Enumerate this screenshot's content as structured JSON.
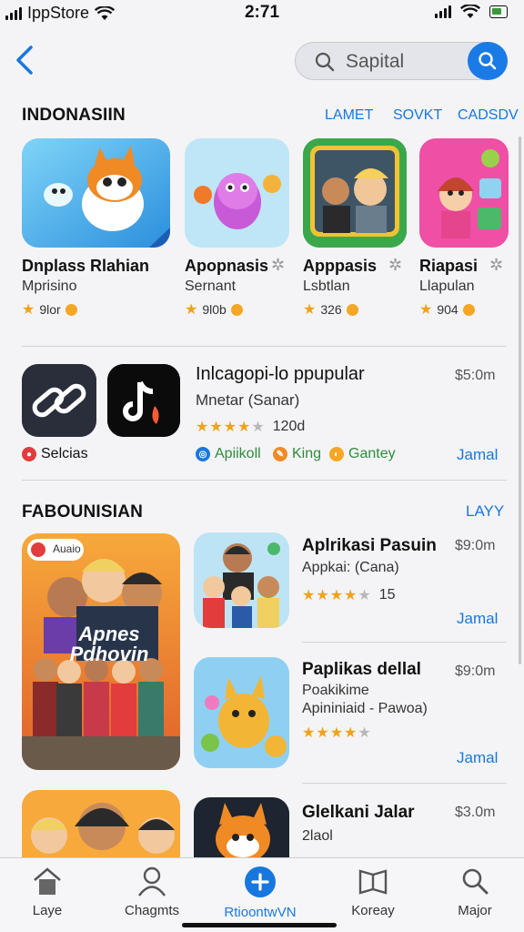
{
  "status": {
    "carrier": "IppStore",
    "time": "2:71"
  },
  "search": {
    "placeholder": "Sapital"
  },
  "section1": {
    "title": "INDONASIIN",
    "tabs": [
      "LAMET",
      "SOVKT",
      "CADSDV"
    ],
    "apps": [
      {
        "name": "Dnplass Rlahian",
        "subtitle": "Mprisino",
        "rating": "9lor"
      },
      {
        "name": "Apopnasis",
        "subtitle": "Sernant",
        "rating": "9l0b"
      },
      {
        "name": "Apppasis",
        "subtitle": "Lsbtlan",
        "rating": "326"
      },
      {
        "name": "Riapasi",
        "subtitle": "Llapulan",
        "rating": "904"
      }
    ]
  },
  "featured": {
    "title": "Inlcagopi-lo ppupular",
    "subtitle": "Mnetar (Sanar)",
    "price": "$5:0m",
    "rating_value": 4.5,
    "rating_count": "120d",
    "badge_label": "Selcias",
    "tags": [
      "Apiikoll",
      "King",
      "Gantey"
    ],
    "action": "Jamal"
  },
  "section2": {
    "title": "FABOUNISIAN",
    "link": "LAYY",
    "hero_badge": "Auaio",
    "hero_caption": "Apnes Pdhovin",
    "items": [
      {
        "title": "Aplrikasi Pasuin",
        "subtitle": "Appkai: (Cana)",
        "price": "$9:0m",
        "rating_value": 4.5,
        "rating_count": "15",
        "action": "Jamal"
      },
      {
        "title": "Paplikas dellal",
        "subtitle": "Poakikime",
        "subtitle2": "Apininiaid - Pawoa)",
        "price": "$9:0m",
        "rating_value": 4.5,
        "action": "Jamal"
      },
      {
        "title": "Glelkani Jalar",
        "subtitle": "2laol",
        "price": "$3.0m"
      }
    ]
  },
  "tabbar": {
    "items": [
      {
        "label": "Laye",
        "icon": "home-icon"
      },
      {
        "label": "Chagmts",
        "icon": "person-icon"
      },
      {
        "label": "RtioontwVN",
        "icon": "plus-circle-icon",
        "active": true
      },
      {
        "label": "Koreay",
        "icon": "book-icon"
      },
      {
        "label": "Major",
        "icon": "search-icon"
      }
    ]
  },
  "colors": {
    "accent": "#1877df",
    "star": "#f0a21a",
    "background": "#f4f4f6"
  }
}
